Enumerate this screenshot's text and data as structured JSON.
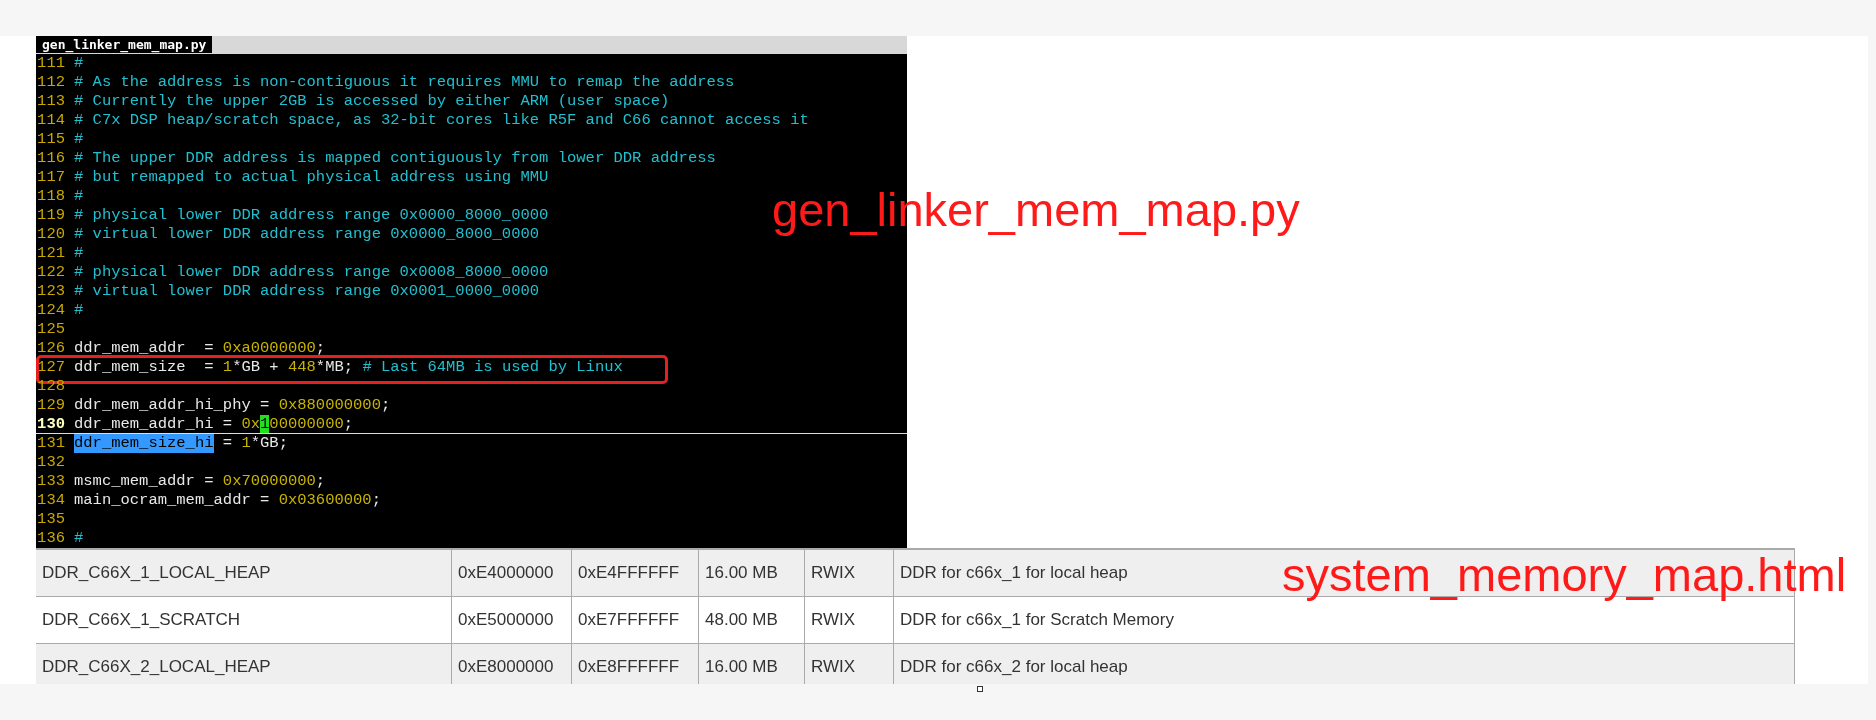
{
  "editor": {
    "tab_title": "gen_linker_mem_map.py",
    "lines": [
      {
        "number": "111",
        "current": false,
        "boxed": false,
        "tokens": [
          {
            "kind": "comment",
            "text": "#"
          }
        ]
      },
      {
        "number": "112",
        "current": false,
        "boxed": false,
        "tokens": [
          {
            "kind": "comment",
            "text": "# As the address is non-contiguous it requires MMU to remap the address"
          }
        ]
      },
      {
        "number": "113",
        "current": false,
        "boxed": false,
        "tokens": [
          {
            "kind": "comment",
            "text": "# Currently the upper 2GB is accessed by either ARM (user space)"
          }
        ]
      },
      {
        "number": "114",
        "current": false,
        "boxed": false,
        "tokens": [
          {
            "kind": "comment",
            "text": "# C7x DSP heap/scratch space, as 32-bit cores like R5F and C66 cannot access it"
          }
        ]
      },
      {
        "number": "115",
        "current": false,
        "boxed": false,
        "tokens": [
          {
            "kind": "comment",
            "text": "#"
          }
        ]
      },
      {
        "number": "116",
        "current": false,
        "boxed": false,
        "tokens": [
          {
            "kind": "comment",
            "text": "# The upper DDR address is mapped contiguously from lower DDR address"
          }
        ]
      },
      {
        "number": "117",
        "current": false,
        "boxed": false,
        "tokens": [
          {
            "kind": "comment",
            "text": "# but remapped to actual physical address using MMU"
          }
        ]
      },
      {
        "number": "118",
        "current": false,
        "boxed": false,
        "tokens": [
          {
            "kind": "comment",
            "text": "#"
          }
        ]
      },
      {
        "number": "119",
        "current": false,
        "boxed": false,
        "tokens": [
          {
            "kind": "comment",
            "text": "# physical lower DDR address range 0x0000_8000_0000"
          }
        ]
      },
      {
        "number": "120",
        "current": false,
        "boxed": false,
        "tokens": [
          {
            "kind": "comment",
            "text": "# virtual lower DDR address range 0x0000_8000_0000"
          }
        ]
      },
      {
        "number": "121",
        "current": false,
        "boxed": false,
        "tokens": [
          {
            "kind": "comment",
            "text": "#"
          }
        ]
      },
      {
        "number": "122",
        "current": false,
        "boxed": false,
        "tokens": [
          {
            "kind": "comment",
            "text": "# physical lower DDR address range 0x0008_8000_0000"
          }
        ]
      },
      {
        "number": "123",
        "current": false,
        "boxed": false,
        "tokens": [
          {
            "kind": "comment",
            "text": "# virtual lower DDR address range 0x0001_0000_0000"
          }
        ]
      },
      {
        "number": "124",
        "current": false,
        "boxed": false,
        "tokens": [
          {
            "kind": "comment",
            "text": "#"
          }
        ]
      },
      {
        "number": "125",
        "current": false,
        "boxed": false
      },
      {
        "number": "126",
        "current": false,
        "boxed": false,
        "tokens": [
          {
            "kind": "plain",
            "text": "ddr_mem_addr  = "
          },
          {
            "kind": "number",
            "text": "0xa0000000"
          },
          {
            "kind": "plain",
            "text": ";"
          }
        ]
      },
      {
        "number": "127",
        "current": false,
        "boxed": true,
        "tokens": [
          {
            "kind": "plain",
            "text": "ddr_mem_size  = "
          },
          {
            "kind": "number",
            "text": "1"
          },
          {
            "kind": "plain",
            "text": "*GB + "
          },
          {
            "kind": "number",
            "text": "448"
          },
          {
            "kind": "plain",
            "text": "*MB; "
          },
          {
            "kind": "comment",
            "text": "# Last 64MB is used by Linux"
          }
        ]
      },
      {
        "number": "128",
        "current": false,
        "boxed": false
      },
      {
        "number": "129",
        "current": false,
        "boxed": false,
        "tokens": [
          {
            "kind": "plain",
            "text": "ddr_mem_addr_hi_phy = "
          },
          {
            "kind": "number",
            "text": "0x880000000"
          },
          {
            "kind": "plain",
            "text": ";"
          }
        ]
      },
      {
        "number": "130",
        "current": true,
        "boxed": false,
        "tokens": [
          {
            "kind": "plain",
            "text": "ddr_mem_addr_hi = "
          },
          {
            "kind": "number",
            "text": "0x"
          },
          {
            "kind": "cursor",
            "text": "1"
          },
          {
            "kind": "number",
            "text": "00000000"
          },
          {
            "kind": "plain",
            "text": ";"
          }
        ]
      },
      {
        "number": "131",
        "current": false,
        "boxed": false,
        "tokens": [
          {
            "kind": "selection",
            "text": "ddr_mem_size_hi"
          },
          {
            "kind": "plain",
            "text": " = "
          },
          {
            "kind": "number",
            "text": "1"
          },
          {
            "kind": "plain",
            "text": "*GB;"
          }
        ]
      },
      {
        "number": "132",
        "current": false,
        "boxed": false
      },
      {
        "number": "133",
        "current": false,
        "boxed": false,
        "tokens": [
          {
            "kind": "plain",
            "text": "msmc_mem_addr = "
          },
          {
            "kind": "number",
            "text": "0x70000000"
          },
          {
            "kind": "plain",
            "text": ";"
          }
        ]
      },
      {
        "number": "134",
        "current": false,
        "boxed": false,
        "tokens": [
          {
            "kind": "plain",
            "text": "main_ocram_mem_addr = "
          },
          {
            "kind": "number",
            "text": "0x03600000"
          },
          {
            "kind": "plain",
            "text": ";"
          }
        ]
      },
      {
        "number": "135",
        "current": false,
        "boxed": false
      },
      {
        "number": "136",
        "current": false,
        "boxed": false,
        "tokens": [
          {
            "kind": "comment",
            "text": "#"
          }
        ]
      }
    ]
  },
  "annotations": [
    "gen_linker_mem_map.py",
    "system_memory_map.html"
  ],
  "table": {
    "rows": [
      {
        "cells": [
          "DDR_C66X_1_LOCAL_HEAP",
          "0xE4000000",
          "0xE4FFFFFF",
          "16.00 MB",
          "RWIX",
          "DDR for c66x_1 for local heap"
        ]
      },
      {
        "cells": [
          "DDR_C66X_1_SCRATCH",
          "0xE5000000",
          "0xE7FFFFFF",
          "48.00 MB",
          "RWIX",
          "DDR for c66x_1 for Scratch Memory"
        ]
      },
      {
        "cells": [
          "DDR_C66X_2_LOCAL_HEAP",
          "0xE8000000",
          "0xE8FFFFFF",
          "16.00 MB",
          "RWIX",
          "DDR for c66x_2 for local heap"
        ]
      }
    ]
  }
}
